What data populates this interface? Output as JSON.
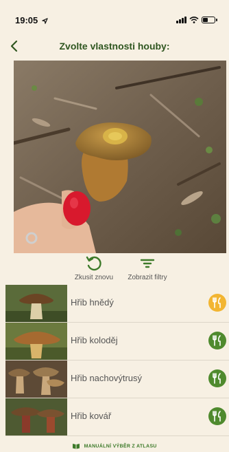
{
  "status": {
    "time": "19:05"
  },
  "nav": {
    "title": "Zvolte vlastnosti houby:"
  },
  "actions": {
    "retry_label": "Zkusit znovu",
    "filters_label": "Zobrazit filtry"
  },
  "results": [
    {
      "name": "Hřib hnědý",
      "badge": "edible-icon",
      "badge_color": "#f2b532"
    },
    {
      "name": "Hřib koloděj",
      "badge": "edible-icon",
      "badge_color": "#4f8a2e"
    },
    {
      "name": "Hřib nachovýtrusý",
      "badge": "edible-icon",
      "badge_color": "#4f8a2e"
    },
    {
      "name": "Hřib kovář",
      "badge": "edible-icon",
      "badge_color": "#4f8a2e"
    }
  ],
  "manual_link": "MANUÁLNÍ VÝBĚR Z ATLASU",
  "colors": {
    "accent": "#2f5620",
    "background": "#f7f0e3",
    "link": "#3d7a2a"
  }
}
